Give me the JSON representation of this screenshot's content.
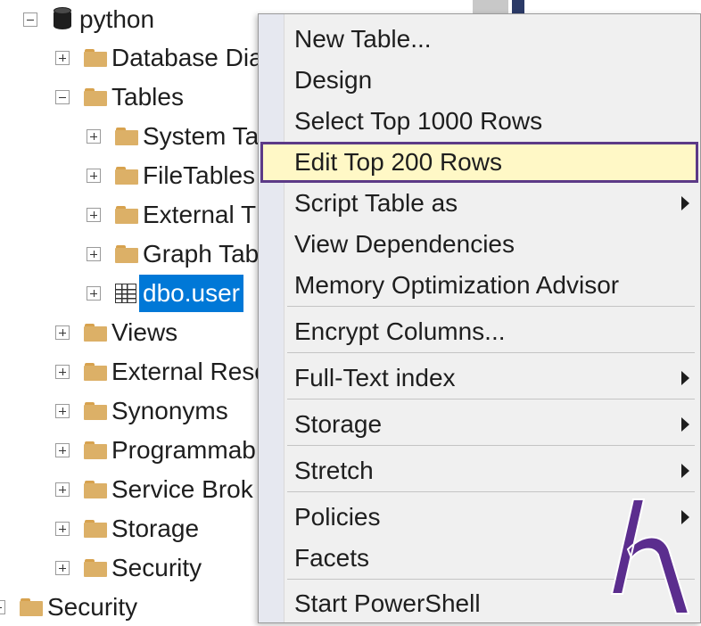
{
  "tree": {
    "nodes": [
      {
        "label": "python",
        "depth": 1,
        "expander": "minus",
        "icon": "database"
      },
      {
        "label": "Database Dia",
        "depth": 2,
        "expander": "plus",
        "icon": "folder"
      },
      {
        "label": "Tables",
        "depth": 2,
        "expander": "minus",
        "icon": "folder"
      },
      {
        "label": "System Ta",
        "depth": 3,
        "expander": "plus",
        "icon": "folder"
      },
      {
        "label": "FileTables",
        "depth": 3,
        "expander": "plus",
        "icon": "folder"
      },
      {
        "label": "External T",
        "depth": 3,
        "expander": "plus",
        "icon": "folder"
      },
      {
        "label": "Graph Tab",
        "depth": 3,
        "expander": "plus",
        "icon": "folder"
      },
      {
        "label": "dbo.user",
        "depth": 3,
        "expander": "plus",
        "icon": "table",
        "selected": true
      },
      {
        "label": "Views",
        "depth": 2,
        "expander": "plus",
        "icon": "folder"
      },
      {
        "label": "External Reso",
        "depth": 2,
        "expander": "plus",
        "icon": "folder"
      },
      {
        "label": "Synonyms",
        "depth": 2,
        "expander": "plus",
        "icon": "folder"
      },
      {
        "label": "Programmab",
        "depth": 2,
        "expander": "plus",
        "icon": "folder"
      },
      {
        "label": "Service Brok",
        "depth": 2,
        "expander": "plus",
        "icon": "folder"
      },
      {
        "label": "Storage",
        "depth": 2,
        "expander": "plus",
        "icon": "folder"
      },
      {
        "label": "Security",
        "depth": 2,
        "expander": "plus",
        "icon": "folder"
      },
      {
        "label": "Security",
        "depth": 0,
        "expander": "plus",
        "icon": "folder"
      }
    ]
  },
  "context_menu": {
    "items": [
      {
        "label": "New Table...",
        "submenu": false
      },
      {
        "label": "Design",
        "submenu": false
      },
      {
        "label": "Select Top 1000 Rows",
        "submenu": false
      },
      {
        "label": "Edit Top 200 Rows",
        "submenu": false,
        "highlighted": true
      },
      {
        "label": "Script Table as",
        "submenu": true
      },
      {
        "label": "View Dependencies",
        "submenu": false
      },
      {
        "label": "Memory Optimization Advisor",
        "submenu": false,
        "separator_after": true
      },
      {
        "label": "Encrypt Columns...",
        "submenu": false,
        "separator_after": true
      },
      {
        "label": "Full-Text index",
        "submenu": true,
        "separator_after": true
      },
      {
        "label": "Storage",
        "submenu": true,
        "separator_after": true
      },
      {
        "label": "Stretch",
        "submenu": true,
        "separator_after": true
      },
      {
        "label": "Policies",
        "submenu": true
      },
      {
        "label": "Facets",
        "submenu": false,
        "separator_after": true
      },
      {
        "label": "Start PowerShell",
        "submenu": false
      }
    ]
  },
  "colors": {
    "selection": "#0078d7",
    "highlight_fill": "#fff8c6",
    "highlight_border": "#5c3a87",
    "logo": "#5b2d8e"
  },
  "logo": {
    "icon": "h-logo"
  }
}
